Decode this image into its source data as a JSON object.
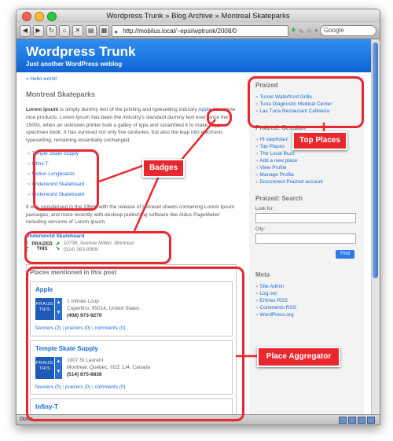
{
  "browser": {
    "window_title": "Wordpress Trunk » Blog Archive » Montreal Skateparks",
    "url": "http://mobilus.local/~epsi/wptrunk/2008/0",
    "search_placeholder": "Google",
    "status": "Done"
  },
  "site": {
    "title": "Wordpress Trunk",
    "tagline": "Just another WordPress weblog"
  },
  "post": {
    "breadcrumb": "« Hello world!",
    "title": "Montreal Skateparks",
    "para1_bold": "Lorem Ipsum",
    "para1_a": " is simply dummy text of the printing and typesetting industry ",
    "para1_link": "Apple",
    "para1_b": " has some nice products. Lorem Ipsum has been the industry's standard dummy text ever since the 1500s, when an unknown printer took a galley of type and scrambled it to make a type specimen book. It has survived not only five centuries, but also the leap into electronic typesetting, remaining essentially unchanged.",
    "badges": [
      "Temple Skate Supply",
      "Infiny-T",
      "Motion Longboards",
      "Underworld Skateboard",
      "Underworld Skateboard"
    ],
    "para2": "It was popularised in the 1960s with the release of Letraset sheets containing Lorem Ipsum passages, and more recently with desktop publishing software like Aldus PageMaker including versions of Lorem Ipsum.",
    "inline_place": {
      "name": "Underworld Skateboard",
      "count_top": "1",
      "count_bottom": "1",
      "praized_word": "PRAIZED",
      "this_word": "THIS",
      "address": "10738, Avenue Millen, Montreal",
      "phone": "(514) 383-9999"
    }
  },
  "aggregator": {
    "title": "Places mentioned in this post",
    "praize_label_1": "PRAIZE",
    "praize_label_2": "THIS",
    "places": [
      {
        "name": "Apple",
        "line1": "1 Infinite Loop",
        "line2": "Cupertino, 95014, United States",
        "phone": "(408) 973-9270",
        "favorers": "favorers (2)",
        "praizers": "praizers (0)",
        "comments": "comments (0)"
      },
      {
        "name": "Temple Skate Supply",
        "line1": "1007 St Laurent",
        "line2": "Montreal, Quebec, H2Z 1J4, Canada",
        "phone": "(514) 875-8838",
        "favorers": "favorers (0)",
        "praizers": "praizers (0)",
        "comments": "comments (0)"
      },
      {
        "name": "Infiny-T"
      }
    ]
  },
  "sidebar": {
    "praized_title": "Praized",
    "top_places": [
      "Tunas Waterfront Grille",
      "Tuna Diagnostic Medical Center",
      "Las Tuna Restaurant Cafeteria"
    ],
    "session_title": "Praized: Session",
    "session_items": [
      "Hi stephdau!",
      "Top Places",
      "The Local Buzz",
      "Add a new place",
      "View Profile",
      "Manage Profile",
      "Disconnect Praized account"
    ],
    "search_title": "Praized: Search",
    "look_for_label": "Look for:",
    "city_label": "City:",
    "find_button": "Find",
    "meta_title": "Meta",
    "meta_items": [
      "Site Admin",
      "Log out",
      "Entries RSS",
      "Comments RSS",
      "WordPress.org"
    ]
  },
  "annotations": {
    "badges": "Badges",
    "top_places": "Top Places",
    "place_aggregator": "Place Aggregator"
  },
  "colors": {
    "annotation_red": "#e8282e",
    "header_blue": "#1a72e0",
    "link_blue": "#1a6ad3"
  }
}
